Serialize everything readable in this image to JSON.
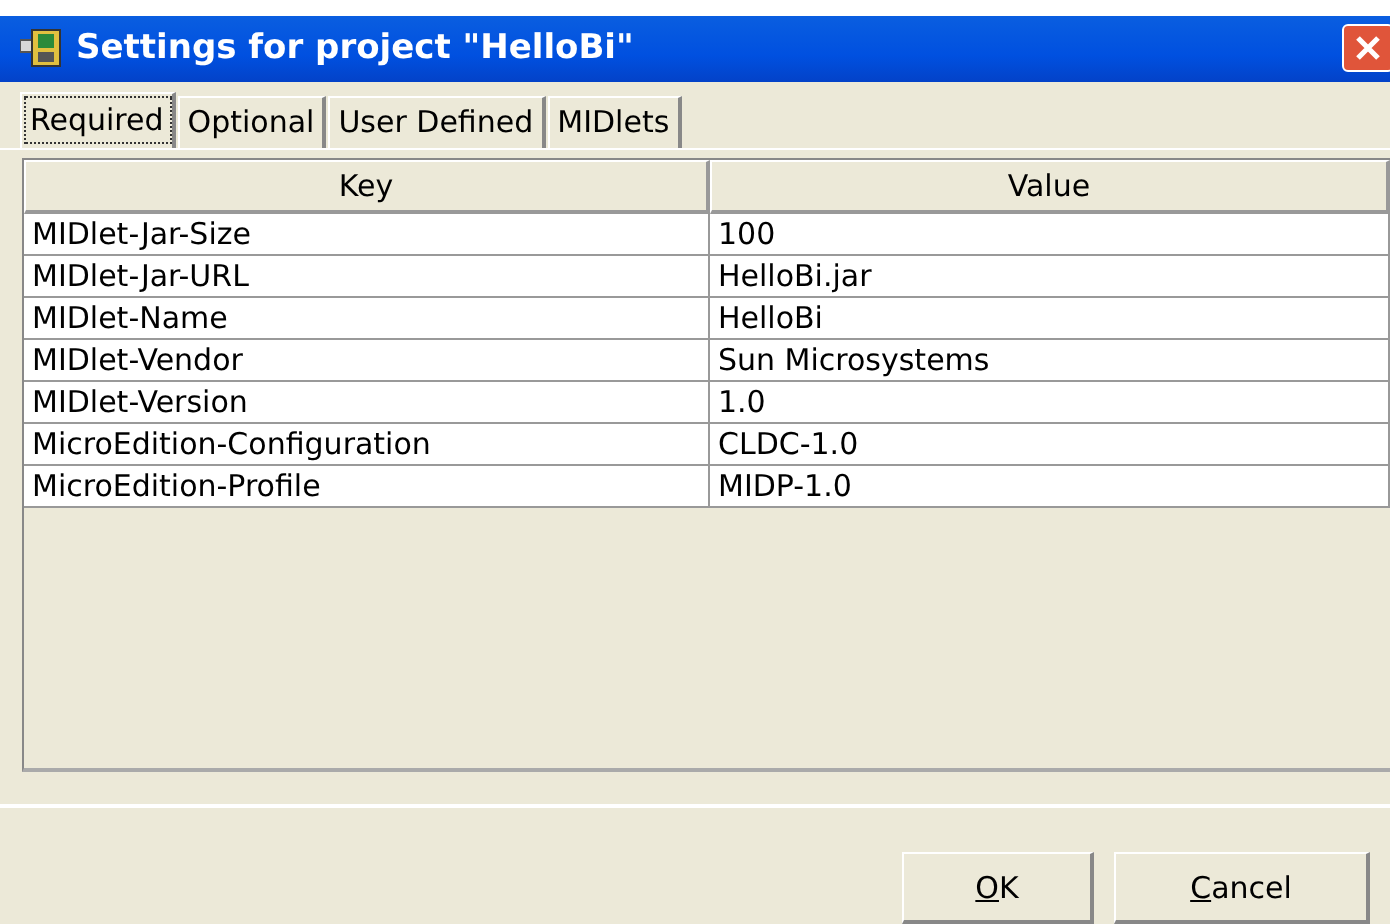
{
  "window": {
    "title": "Settings for project \"HelloBi\""
  },
  "tabs": [
    {
      "label": "Required",
      "selected": true
    },
    {
      "label": "Optional",
      "selected": false
    },
    {
      "label": "User Defined",
      "selected": false
    },
    {
      "label": "MIDlets",
      "selected": false
    }
  ],
  "table": {
    "columns": [
      "Key",
      "Value"
    ],
    "rows": [
      [
        "MIDlet-Jar-Size",
        "100"
      ],
      [
        "MIDlet-Jar-URL",
        "HelloBi.jar"
      ],
      [
        "MIDlet-Name",
        "HelloBi"
      ],
      [
        "MIDlet-Vendor",
        "Sun Microsystems"
      ],
      [
        "MIDlet-Version",
        "1.0"
      ],
      [
        "MicroEdition-Configuration",
        "CLDC-1.0"
      ],
      [
        "MicroEdition-Profile",
        "MIDP-1.0"
      ]
    ]
  },
  "buttons": [
    {
      "mnemonic": "O",
      "label_rest": "K"
    },
    {
      "mnemonic": "C",
      "label_rest": "ancel"
    }
  ]
}
